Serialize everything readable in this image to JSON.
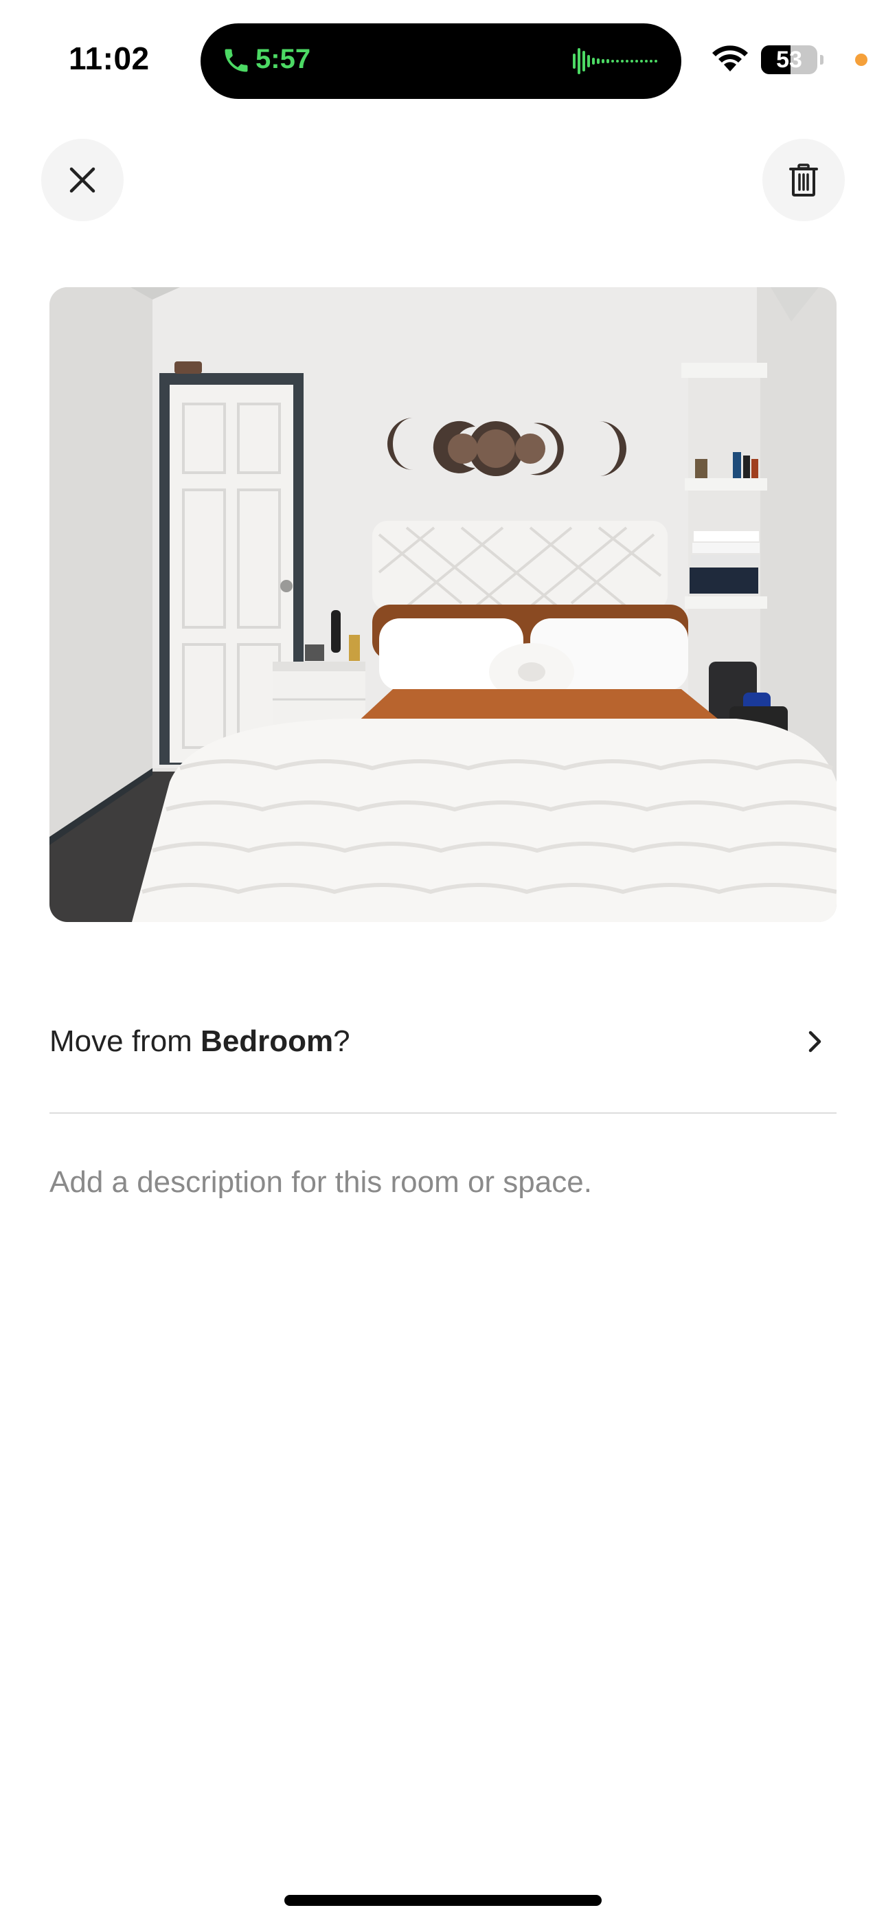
{
  "status_bar": {
    "time": "11:02",
    "call": {
      "duration": "5:57",
      "icon": "phone-icon",
      "color": "#4cd964"
    },
    "wifi_icon": "wifi-icon",
    "battery": {
      "level": "53",
      "fraction": 0.53
    },
    "privacy_dot_color": "#f5a03a"
  },
  "toolbar": {
    "close_icon": "close-icon",
    "delete_icon": "trash-icon"
  },
  "photo": {
    "alt": "Bedroom photo"
  },
  "move": {
    "prefix": "Move from ",
    "room": "Bedroom",
    "suffix": "?",
    "chevron_icon": "chevron-right-icon"
  },
  "description": {
    "value": "",
    "placeholder": "Add a description for this room or space."
  }
}
